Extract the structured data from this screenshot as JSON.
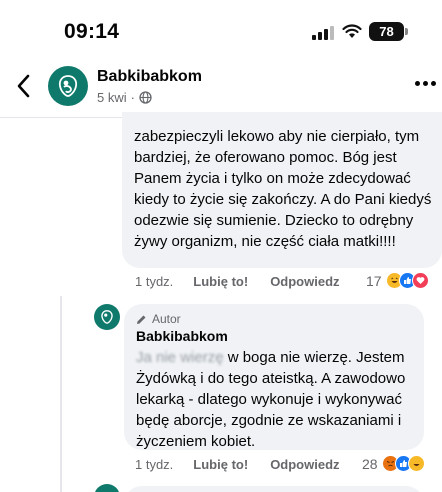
{
  "status_bar": {
    "time": "09:14",
    "battery": "78"
  },
  "header": {
    "page_name": "Babkibabkom",
    "post_age": "5 kwi",
    "dot": "·"
  },
  "comment_1": {
    "text": "zabezpieczyli lekowo aby nie cierpiało, tym bardziej, że oferowano pomoc. Bóg jest Panem życia i tylko on może zdecydować kiedy to życie się zakończy. A do Pani kiedyś odezwie się sumienie. Dziecko to odrębny żywy organizm, nie część ciała matki!!!!",
    "time_ago": "1 tydz.",
    "like_label": "Lubię to!",
    "reply_label": "Odpowiedz",
    "reaction_count": "17"
  },
  "reply_1": {
    "author_badge": "Autor",
    "name": "Babkibabkom",
    "text_blurred": "Ja nie wierzę",
    "text_visible": " w boga nie wierzę. Jestem Żydówką i do tego ateistką. A zawodowo lekarką - dlatego wykonuje i wykonywać będę aborcje, zgodnie ze wskazaniami i życzeniem kobiet.",
    "time_ago": "1 tydz.",
    "like_label": "Lubię to!",
    "reply_label": "Odpowiedz",
    "reaction_count": "28"
  },
  "colors": {
    "brand": "#0f7a6b",
    "bubble": "#f0f2f5",
    "like_blue": "#1877f2",
    "angry": "#e9710f",
    "love": "#f33e58"
  },
  "icons": [
    "back-icon",
    "globe-icon",
    "more-icon",
    "pencil-icon",
    "haha-icon",
    "like-icon",
    "love-icon",
    "angry-icon"
  ]
}
